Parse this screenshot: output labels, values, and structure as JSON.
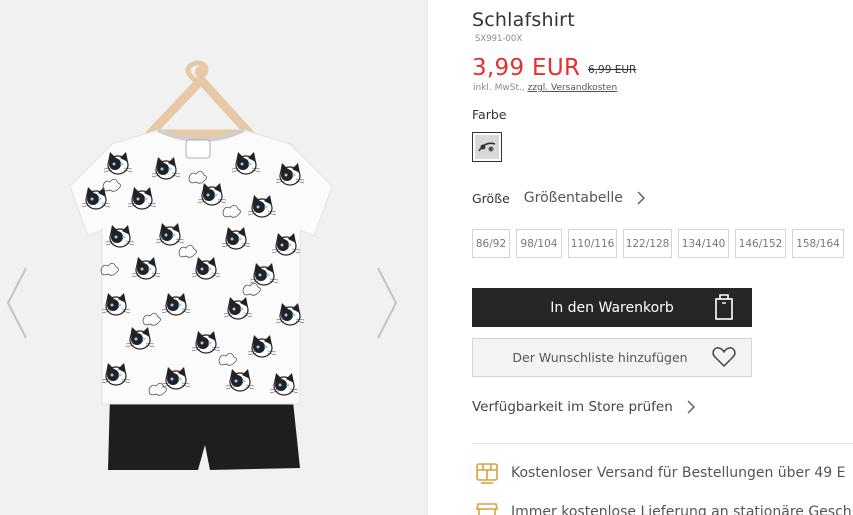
{
  "product": {
    "title": "Schlafshirt",
    "sku": "SX991-00X",
    "price": "3,99 EUR",
    "old_price": "6,99 EUR",
    "tax_text": "inkl. MwSt., ",
    "shipping_link": "zzgl. Versandkosten"
  },
  "color": {
    "label": "Farbe"
  },
  "size": {
    "label": "Größe",
    "table_link": "Größentabelle",
    "options": [
      "86/92",
      "98/104",
      "110/116",
      "122/128",
      "134/140",
      "146/152",
      "158/164"
    ]
  },
  "actions": {
    "add_to_cart": "In den Warenkorb",
    "wishlist": "Der Wunschliste hinzufügen",
    "store_availability": "Verfügbarkeit im Store prüfen"
  },
  "benefits": [
    {
      "icon": "free-shipping-icon",
      "text": "Kostenloser Versand für Bestellungen über 49 E"
    },
    {
      "icon": "store-delivery-icon",
      "text": "Immer kostenlose Lieferung an stationäre Gesch"
    }
  ],
  "colors": {
    "price": "#e4312e",
    "button_dark": "#262626",
    "icon_accent": "#d9a13a"
  }
}
